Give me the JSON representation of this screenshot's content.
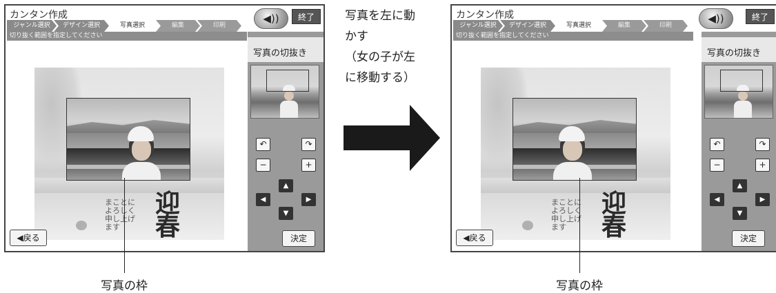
{
  "screens": [
    {
      "app_title": "カンタン作成",
      "steps": [
        "ジャンル選択",
        "デザイン選択",
        "写真選択",
        "編集",
        "印刷"
      ],
      "active_step": "写真選択",
      "instruction": "切り抜く範囲を指定してください",
      "panel_title": "写真の切抜き",
      "sound_icon": "◀))",
      "end_label": "終了",
      "rotate_left": "↶",
      "rotate_right": "↷",
      "zoom_out": "−",
      "zoom_in": "+",
      "move_up": "▲",
      "move_down": "▼",
      "move_left": "◀",
      "move_right": "▶",
      "decide_label": "決定",
      "back_label": "◀戻る",
      "card_kanji": "迎春",
      "card_brush": "まことに よろしく 申し上げます"
    },
    {
      "app_title": "カンタン作成",
      "steps": [
        "ジャンル選択",
        "デザイン選択",
        "写真選択",
        "編集",
        "印刷"
      ],
      "active_step": "写真選択",
      "instruction": "切り抜く範囲を指定してください",
      "panel_title": "写真の切抜き",
      "sound_icon": "◀))",
      "end_label": "終了",
      "rotate_left": "↶",
      "rotate_right": "↷",
      "zoom_out": "−",
      "zoom_in": "+",
      "move_up": "▲",
      "move_down": "▼",
      "move_left": "◀",
      "move_right": "▶",
      "decide_label": "決定",
      "back_label": "◀戻る",
      "card_kanji": "迎春",
      "card_brush": "まことに よろしく 申し上げます"
    }
  ],
  "annotation": {
    "line1": "写真を左に動",
    "line2": "かす",
    "line3": "（女の子が左",
    "line4": "に移動する）"
  },
  "captions": {
    "left": "写真の枠",
    "right": "写真の枠"
  }
}
